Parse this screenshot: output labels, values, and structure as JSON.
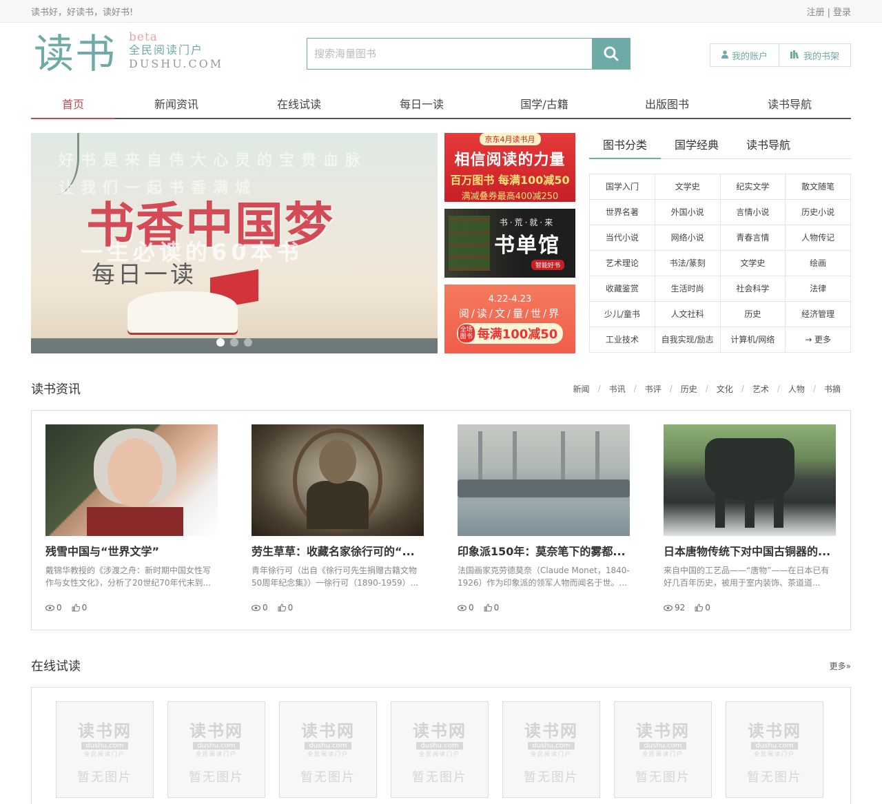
{
  "topbar": {
    "slogan": "读书好，好读书，读好书!",
    "register": "注册",
    "sep": "|",
    "login": "登录"
  },
  "logo": {
    "mark": "读书",
    "beta": "beta",
    "slogan": "全民阅读门户",
    "domain": "DUSHU.COM"
  },
  "search": {
    "placeholder": "搜索海量图书",
    "icon": "search-icon"
  },
  "account": {
    "my_account": "我的账户",
    "my_shelf": "我的书架"
  },
  "nav": [
    "首页",
    "新闻资讯",
    "在线试读",
    "每日一读",
    "国学/古籍",
    "出版图书",
    "读书导航"
  ],
  "banner": {
    "ghost_line1": "好书是来自伟大心灵的宝贵血脉",
    "ghost_line2": "让我们一起书香满城",
    "title": "书香中国梦",
    "sub": "一生必读的60本书",
    "daily": "每日一读"
  },
  "ads": {
    "ad1": {
      "tag": "京东4月读书月",
      "t1": "相信阅读的力量",
      "t2": "百万图书 每满100减50",
      "t3": "满减叠券最高400减250"
    },
    "ad2": {
      "t1": "书·荒·就·来",
      "t2": "书单馆",
      "t3": "智能好书"
    },
    "ad3": {
      "t1": "4.22-4.23",
      "t2": "阅/读/文/量/世/界",
      "mini": "全场图书",
      "big": "每满100减50"
    }
  },
  "category": {
    "tabs": [
      "图书分类",
      "国学经典",
      "读书导航"
    ],
    "items": [
      "国学入门",
      "文学史",
      "纪实文学",
      "散文随笔",
      "世界名著",
      "外国小说",
      "言情小说",
      "历史小说",
      "当代小说",
      "网络小说",
      "青春言情",
      "人物传记",
      "艺术理论",
      "书法/篆刻",
      "文学史",
      "绘画",
      "收藏鉴赏",
      "生活时尚",
      "社会科学",
      "法律",
      "少儿/童书",
      "人文社科",
      "历史",
      "经济管理",
      "工业技术",
      "自我实现/励志",
      "计算机/网络",
      "→ 更多"
    ]
  },
  "news_section": {
    "title": "读书资讯",
    "tags": [
      "新闻",
      "书讯",
      "书评",
      "历史",
      "文化",
      "艺术",
      "人物",
      "书摘"
    ],
    "items": [
      {
        "title": "残雪中国与“世界文学”",
        "desc": "戴锦华教授的《涉渡之舟：新时期中国女性写作与女性文化》，分析了20世纪70年代末到...",
        "views": "0",
        "likes": "0"
      },
      {
        "title": "劳生草草：收藏名家徐行可的“...",
        "desc": "青年徐行可（出自《徐行可先生捐赠古籍文物50周年纪念集》）一徐行可（1890-1959）...",
        "views": "0",
        "likes": "0"
      },
      {
        "title": "印象派150年：莫奈笔下的雾都...",
        "desc": "法国画家克劳德莫奈（Claude Monet，1840-1926）作为印象派的领军人物而闻名于世。...",
        "views": "0",
        "likes": "0"
      },
      {
        "title": "日本唐物传统下对中国古铜器的...",
        "desc": "来自中国的工艺品——“唐物”——在日本已有好几百年历史，被用于室内装饰、茶道道...",
        "views": "92",
        "likes": "0"
      }
    ]
  },
  "trial_section": {
    "title": "在线试读",
    "more": "更多»",
    "placeholder": {
      "w1": "读书网",
      "w2": "dushu.com",
      "w3": "全民阅读门户",
      "w4": "暂无图片"
    },
    "count_items": [
      "1",
      "2",
      "3",
      "4",
      "5",
      "6",
      "7"
    ]
  },
  "colors": {
    "accent": "#6eaaa6",
    "nav_active": "#c7474e"
  }
}
